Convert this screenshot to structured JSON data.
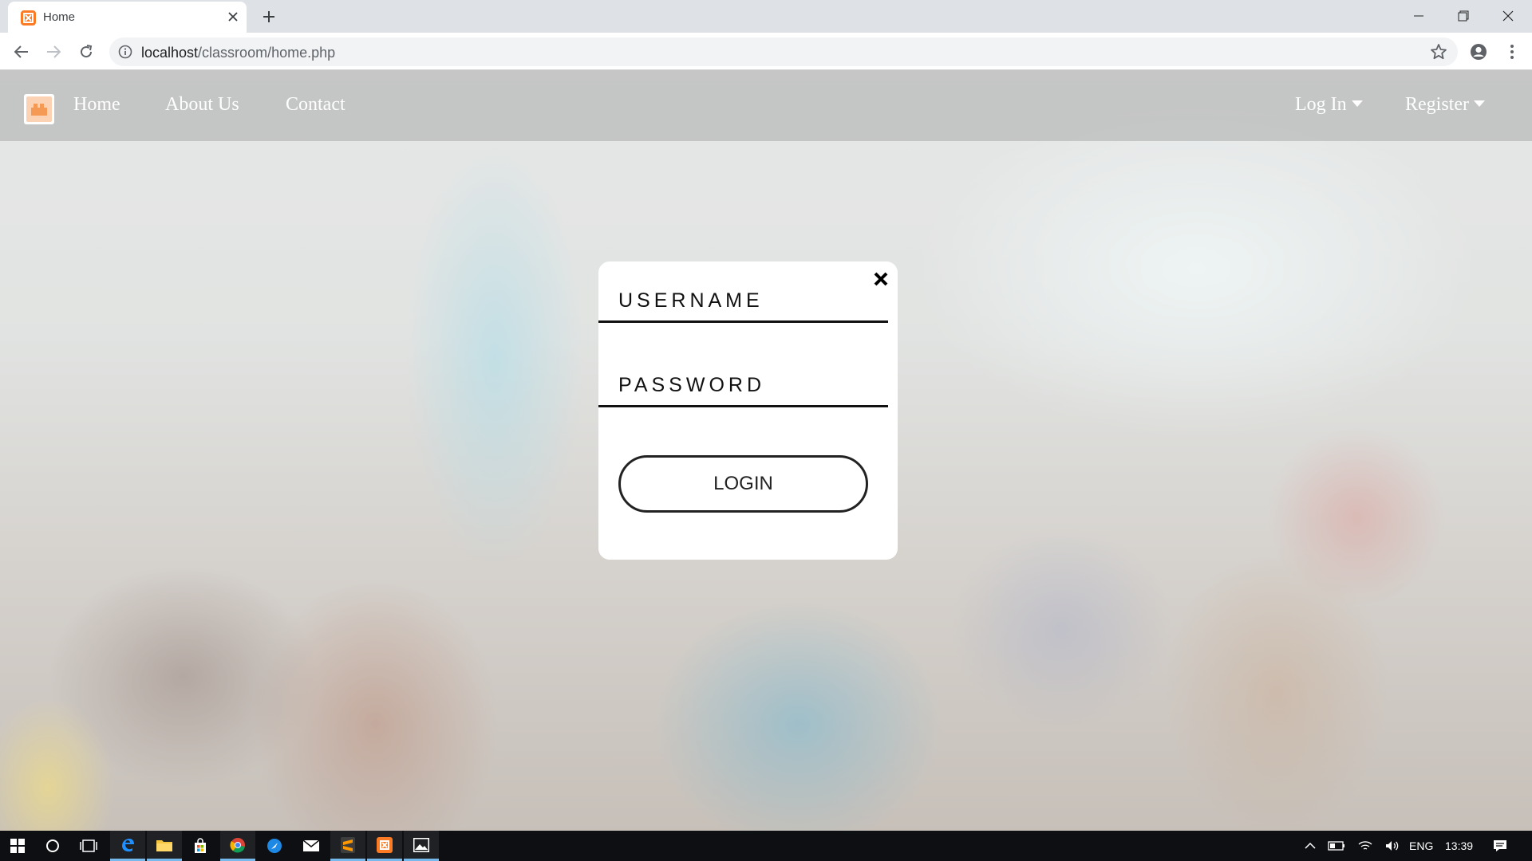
{
  "browser": {
    "tab_title": "Home",
    "url_host": "localhost",
    "url_path": "/classroom/home.php"
  },
  "site": {
    "nav_links": [
      "Home",
      "About Us",
      "Contact"
    ],
    "log_in": "Log In",
    "register": "Register"
  },
  "login_modal": {
    "username_placeholder": "USERNAME",
    "password_placeholder": "PASSWORD",
    "login_button": "LOGIN"
  },
  "taskbar": {
    "language": "ENG",
    "time": "13:39",
    "pinned_icons": [
      "start-icon",
      "cortana-icon",
      "task-view-icon",
      "edge-icon",
      "file-explorer-icon",
      "store-icon",
      "chrome-icon",
      "browser-blue-icon",
      "mail-icon",
      "sublime-text-icon",
      "xampp-icon",
      "photos-icon"
    ]
  },
  "colors": {
    "tab_strip": "#dee1e6",
    "xampp_orange": "#fb7a24",
    "taskbar": "#0d0f12",
    "taskbar_active": "#76b9ed"
  }
}
